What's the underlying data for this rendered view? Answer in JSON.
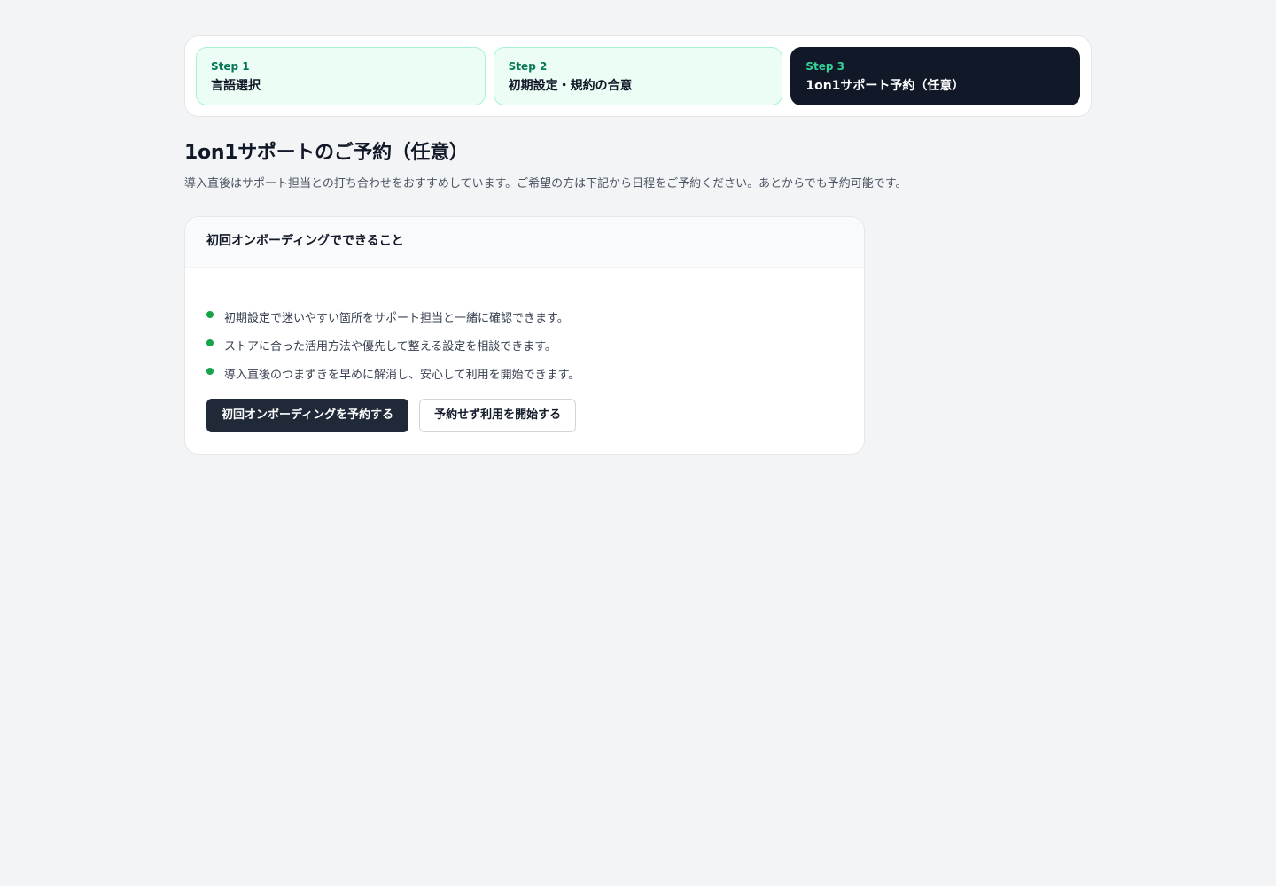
{
  "stepper": {
    "steps": [
      {
        "label": "Step 1",
        "title": "言語選択"
      },
      {
        "label": "Step 2",
        "title": "初期設定・規約の合意"
      },
      {
        "label": "Step 3",
        "title": "1on1サポート予約（任意）"
      }
    ],
    "active_step": 3
  },
  "page": {
    "title": "1on1サポートのご予約（任意）",
    "description": "導入直後はサポート担当との打ち合わせをおすすめしています。ご希望の方は下記から日程をご予約ください。あとからでも予約可能です。"
  },
  "card": {
    "title": "初回オンボーディングでできること",
    "items": [
      "初期設定で迷いやすい箇所をサポート担当と一緒に確認できます。",
      "ストアに合った活用方法や優先して整える設定を相談できます。",
      "導入直後のつまずきを早めに解消し、安心して利用を開始できます。"
    ],
    "primary_button": "初回オンボーディングを予約する",
    "secondary_button": "予約せず利用を開始する"
  },
  "colors": {
    "accent": "#16a34a",
    "dark": "#111827",
    "step_bg": "#ecfdf5"
  }
}
